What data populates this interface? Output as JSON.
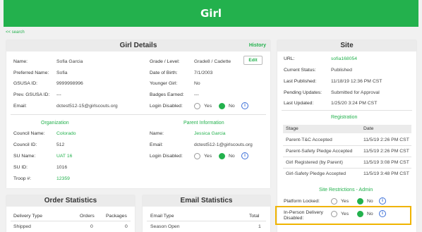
{
  "header": {
    "title": "Girl"
  },
  "nav": {
    "back_label": "<< search"
  },
  "girl_details": {
    "title": "Girl Details",
    "history_label": "History",
    "edit_label": "Edit",
    "fields": {
      "name_label": "Name:",
      "name": "Sofia Garcia",
      "preferred_label": "Preferred Name:",
      "preferred": "Sofia",
      "gsusa_label": "GSUSA ID:",
      "gsusa": "9999998996",
      "prev_gsusa_label": "Prev. GSUSA ID:",
      "prev_gsusa": "---",
      "email_label": "Email:",
      "email": "dctest512-15@girlscouts.org",
      "grade_label": "Grade / Level:",
      "grade": "Grade8 / Cadette",
      "dob_label": "Date of Birth:",
      "dob": "7/1/2003",
      "younger_label": "Younger Girl:",
      "younger": "No",
      "badges_label": "Badges Earned:",
      "badges": "---",
      "login_label": "Login Disabled:",
      "yes_label": "Yes",
      "no_label": "No"
    },
    "organization": {
      "title": "Organization",
      "council_name_label": "Council Name:",
      "council_name": "Colorado",
      "council_id_label": "Council ID:",
      "council_id": "512",
      "su_name_label": "SU Name:",
      "su_name": "UAT 16",
      "su_id_label": "SU ID:",
      "su_id": "1016",
      "troop_label": "Troop #:",
      "troop": "12359"
    },
    "parent": {
      "title": "Parent Information",
      "name_label": "Name:",
      "name": "Jessica Garcia",
      "email_label": "Email:",
      "email": "dctest512-1@girlscouts.org",
      "login_label": "Login Disabled:",
      "yes_label": "Yes",
      "no_label": "No"
    }
  },
  "site": {
    "title": "Site",
    "url_label": "URL:",
    "url": "sofia168054",
    "status_label": "Current Status:",
    "status": "Published",
    "last_published_label": "Last Published:",
    "last_published": "11/18/19 12:36 PM CST",
    "pending_label": "Pending Updates:",
    "pending": "Submitted for Approval",
    "last_updated_label": "Last Updated:",
    "last_updated": "1/25/20 3:24 PM CST",
    "registration": {
      "title": "Registration",
      "col_stage": "Stage",
      "col_date": "Date",
      "rows": [
        {
          "stage": "Parent-T&C Accepted",
          "date": "11/5/19 2:26 PM CST"
        },
        {
          "stage": "Parent-Safety Pledge Accepted",
          "date": "11/5/19 2:26 PM CST"
        },
        {
          "stage": "Girl Registered (by Parent)",
          "date": "11/5/19 3:08 PM CST"
        },
        {
          "stage": "Girl-Safety Pledge Accepted",
          "date": "11/5/19 3:48 PM CST"
        }
      ]
    },
    "restrictions": {
      "title": "Site Restrictions - Admin",
      "platform_label": "Platform Locked:",
      "inperson_label": "In-Person Delivery Disabled:",
      "yes_label": "Yes",
      "no_label": "No"
    }
  },
  "order_stats": {
    "title": "Order Statistics",
    "col_type": "Delivery Type",
    "col_orders": "Orders",
    "col_packages": "Packages",
    "rows": [
      {
        "type": "Shipped",
        "orders": "0",
        "packages": "0"
      }
    ]
  },
  "email_stats": {
    "title": "Email Statistics",
    "col_type": "Email Type",
    "col_total": "Total",
    "rows": [
      {
        "type": "Season Open",
        "total": "1"
      }
    ]
  },
  "colors": {
    "brand": "#23b14d",
    "highlight": "#f0b400",
    "info": "#3b6fd8"
  },
  "icons": {
    "info": "info-icon"
  }
}
